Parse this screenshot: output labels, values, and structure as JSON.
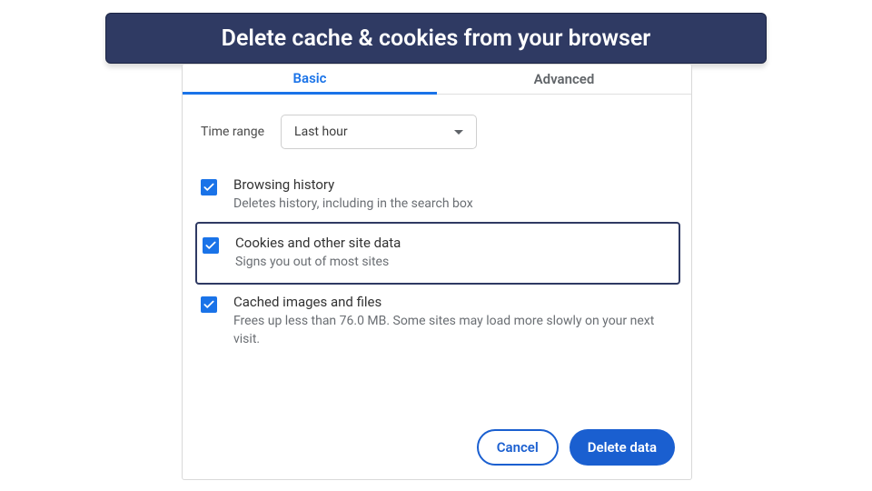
{
  "banner": {
    "text": "Delete cache & cookies from your browser"
  },
  "tabs": {
    "basic": "Basic",
    "advanced": "Advanced"
  },
  "timerange": {
    "label": "Time range",
    "value": "Last hour"
  },
  "options": [
    {
      "title": "Browsing history",
      "desc": "Deletes history, including in the search box",
      "checked": true,
      "highlighted": false
    },
    {
      "title": "Cookies and other site data",
      "desc": "Signs you out of most sites",
      "checked": true,
      "highlighted": true
    },
    {
      "title": "Cached images and files",
      "desc": "Frees up less than 76.0 MB. Some sites may load more slowly on your next visit.",
      "checked": true,
      "highlighted": false
    }
  ],
  "buttons": {
    "cancel": "Cancel",
    "delete": "Delete data"
  }
}
